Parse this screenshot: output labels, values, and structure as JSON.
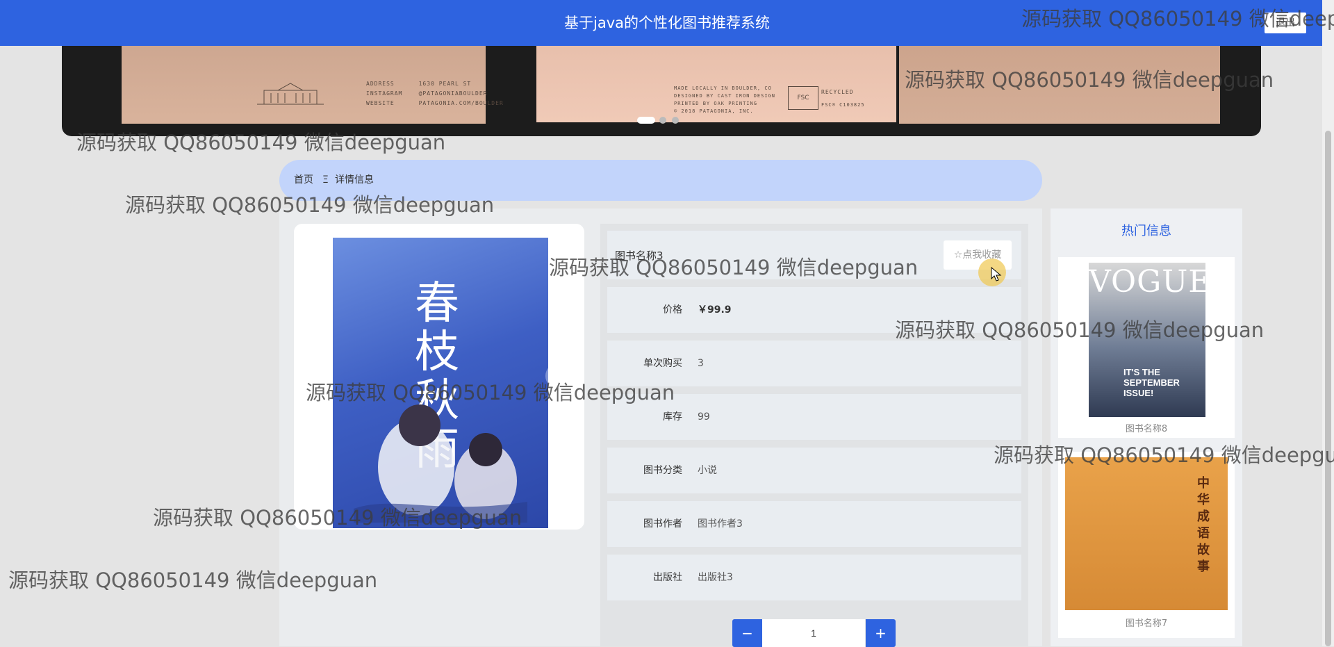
{
  "header": {
    "title": "基于java的个性化图书推荐系统",
    "logout_label": "退出"
  },
  "banner": {
    "slide_text_1": "ADDRESS      1630 PEARL ST\nINSTAGRAM    @PATAGONIABOULDER\nWEBSITE      PATAGONIA.COM/BOULDER",
    "slide_text_2": "MADE LOCALLY IN BOULDER, CO\nDESIGNED BY CAST IRON DESIGN\nPRINTED BY OAK PRINTING\n© 2018 PATAGONIA, INC.",
    "recycled_label": "RECYCLED",
    "fsc_label": "FSC",
    "fsc_code": "FSC® C103825",
    "active_slide": 1,
    "slide_count": 3
  },
  "breadcrumb": {
    "home": "首页",
    "separator": "Ξ",
    "current": "详情信息"
  },
  "gallery": {
    "cover_title": "春枝秋雨",
    "prev_icon": "‹",
    "next_icon": "›"
  },
  "book": {
    "title": "图书名称3",
    "favorite_label": "☆点我收藏",
    "fields": [
      {
        "label": "价格",
        "value": "￥99.9"
      },
      {
        "label": "单次购买",
        "value": "3"
      },
      {
        "label": "库存",
        "value": "99"
      },
      {
        "label": "图书分类",
        "value": "小说"
      },
      {
        "label": "图书作者",
        "value": "图书作者3"
      },
      {
        "label": "出版社",
        "value": "出版社3"
      }
    ]
  },
  "quantity": {
    "minus": "−",
    "value": "1",
    "plus": "+"
  },
  "hot": {
    "title": "热门信息",
    "items": [
      {
        "caption": "图书名称8",
        "cover_text": "VOGUE",
        "cover_sub": "IT'S THE SEPTEMBER ISSUE!"
      },
      {
        "caption": "图书名称7",
        "cover_text": "中华成语故事"
      }
    ]
  },
  "watermark": {
    "text": "源码获取 QQ86050149 微信deepguan"
  },
  "colors": {
    "primary": "#2e63e0",
    "breadcrumb_bg": "#c2d4fb",
    "page_bg": "#e4e4e4"
  }
}
